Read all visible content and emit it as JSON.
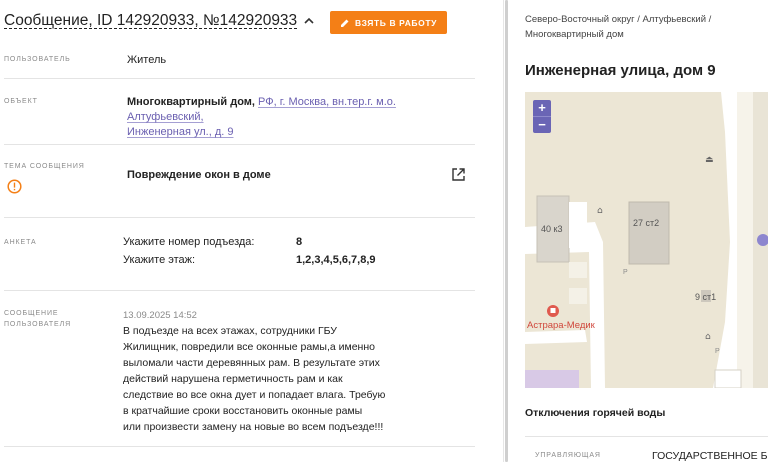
{
  "header": {
    "title": "Сообщение, ID 142920933, №142920933",
    "take_button": "ВЗЯТЬ В РАБОТУ"
  },
  "fields": {
    "user": {
      "label": "ПОЛЬЗОВАТЕЛЬ",
      "value": "Житель"
    },
    "object": {
      "label": "ОБЪЕКТ",
      "type": "Многоквартирный дом,",
      "address_line1": "РФ, г. Москва, вн.тер.г. м.о. Алтуфьевский,",
      "address_line2": "Инженерная ул., д. 9"
    },
    "topic": {
      "label_line1": "ТЕМА СООБЩЕНИЯ",
      "value": "Повреждение окон в доме"
    },
    "anketa": {
      "label": "АНКЕТА",
      "items": [
        {
          "question": "Укажите номер подъезда:",
          "answer": "8"
        },
        {
          "question": "Укажите этаж:",
          "answer": "1,2,3,4,5,6,7,8,9"
        }
      ]
    },
    "message": {
      "label_line1": "СООБЩЕНИЕ",
      "label_line2": "ПОЛЬЗОВАТЕЛЯ",
      "date": "13.09.2025 14:52",
      "lines": [
        "В подъезде на всех этажах, сотрудники ГБУ",
        "Жилищник, повредили все оконные рамы,а именно",
        "выломали части деревянных рам. В результате этих",
        "действий нарушена герметичность рам и как",
        "следствие во все окна дует и попадает влага. Требую",
        "в кратчайшие сроки восстановить оконные рамы",
        "или произвести замену на новые во всем подъезде!!!"
      ]
    }
  },
  "right": {
    "breadcrumb_line1": "Северо-Восточный округ / Алтуфьевский /",
    "breadcrumb_line2": "Многоквартирный дом",
    "address": "Инженерная улица, дом 9",
    "map": {
      "zoom_in": "+",
      "zoom_out": "−",
      "labels": {
        "b1": "40 к3",
        "b2": "27 ст2",
        "b3": "9 ст1",
        "poi": "Астрара-Медик",
        "p": "P"
      }
    },
    "hot_water": "Отключения горячей воды",
    "manager_label": "УПРАВЛЯЮЩАЯ",
    "manager_value": "ГОСУДАРСТВЕННОЕ БЮ"
  },
  "colors": {
    "accent": "#f47f16",
    "link": "#6a5fb0",
    "map_bg": "#ece6d5",
    "zoom": "#6a65b5"
  }
}
